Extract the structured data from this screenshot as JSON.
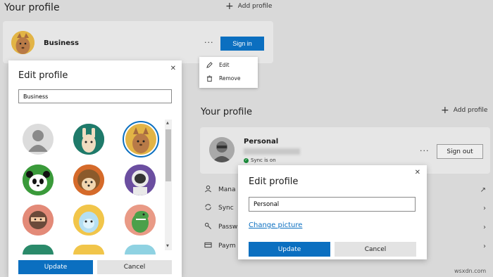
{
  "left_page": {
    "title": "Your profile",
    "add_profile": "Add profile",
    "profile_name": "Business",
    "more": "···",
    "sign_in": "Sign in"
  },
  "context_menu": {
    "items": [
      {
        "label": "Edit",
        "icon": "pencil-icon"
      },
      {
        "label": "Remove",
        "icon": "trash-icon"
      }
    ]
  },
  "edit_dialog_left": {
    "title": "Edit profile",
    "name_value": "Business",
    "update": "Update",
    "cancel": "Cancel",
    "selected_avatar_index": 2
  },
  "right_page": {
    "title": "Your profile",
    "add_profile": "Add profile",
    "profile_name": "Personal",
    "sync_status": "Sync is on",
    "more": "···",
    "sign_out": "Sign out",
    "menu_rows": [
      {
        "label": "Mana",
        "icon": "person-icon",
        "trail": "↗"
      },
      {
        "label": "Sync",
        "icon": "sync-icon",
        "trail": "›"
      },
      {
        "label": "Passw",
        "icon": "key-icon",
        "trail": "›"
      },
      {
        "label": "Paym",
        "icon": "card-icon",
        "trail": "›"
      }
    ]
  },
  "edit_dialog_right": {
    "title": "Edit profile",
    "name_value": "Personal",
    "change_picture": "Change picture",
    "update": "Update",
    "cancel": "Cancel"
  },
  "watermark": "wsxdn.com",
  "colors": {
    "accent": "#0b6fc0",
    "sync_green": "#1a8a3a"
  }
}
